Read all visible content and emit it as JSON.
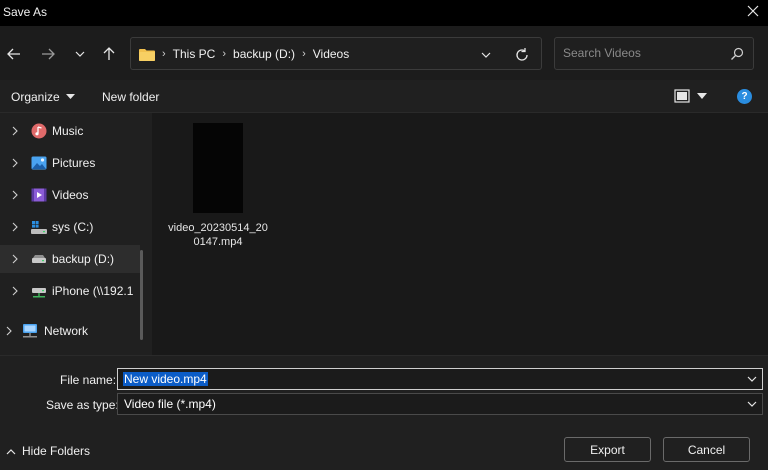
{
  "window": {
    "title": "Save As"
  },
  "address": {
    "crumbs": [
      "This PC",
      "backup (D:)",
      "Videos"
    ]
  },
  "search": {
    "placeholder": "Search Videos"
  },
  "toolbar": {
    "organize_label": "Organize",
    "new_folder_label": "New folder",
    "help_label": "?"
  },
  "nav": {
    "items": [
      {
        "label": "Music",
        "icon": "music-icon"
      },
      {
        "label": "Pictures",
        "icon": "pictures-icon"
      },
      {
        "label": "Videos",
        "icon": "videos-icon"
      },
      {
        "label": "sys (C:)",
        "icon": "windows-drive-icon"
      },
      {
        "label": "backup (D:)",
        "icon": "drive-icon",
        "selected": true
      },
      {
        "label": "iPhone (\\\\192.1",
        "icon": "network-drive-icon"
      },
      {
        "label": "Network",
        "icon": "network-icon"
      }
    ]
  },
  "files": [
    {
      "name": "video_20230514_200147.mp4"
    }
  ],
  "form": {
    "file_name_label": "File name:",
    "file_name_value": "New video.mp4",
    "save_type_label": "Save as type:",
    "save_type_value": "Video file (*.mp4)"
  },
  "footer": {
    "hide_folders_label": "Hide Folders",
    "export_label": "Export",
    "cancel_label": "Cancel"
  },
  "colors": {
    "accent": "#0b5cc7",
    "folder": "#f2c14e",
    "help": "#2a8de0"
  }
}
